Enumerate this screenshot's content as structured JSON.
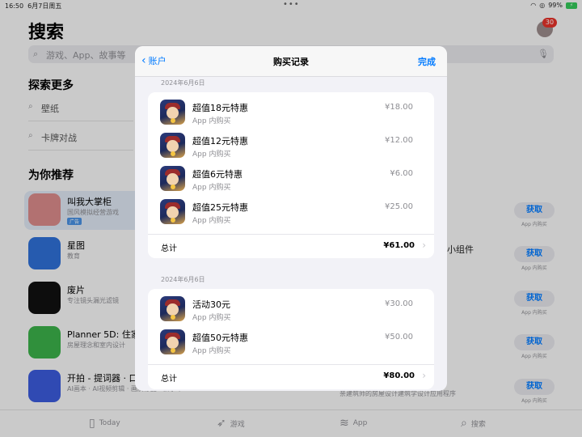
{
  "status_bar": {
    "time": "16:50",
    "date": "6月7日周五",
    "battery": "99%"
  },
  "background": {
    "title": "搜索",
    "badge": "30",
    "search_placeholder": "游戏、App、故事等",
    "explore_title": "探索更多",
    "suggestions": [
      "壁纸",
      "卡牌对战"
    ],
    "recommend_title": "为你推荐",
    "apps": [
      {
        "name": "叫我大掌柜",
        "sub": "国风模拟经营游戏",
        "ad": "广告",
        "icon_color": "#d98a8a"
      },
      {
        "name": "星图",
        "sub": "教育",
        "icon_color": "#2f6fd6"
      },
      {
        "name": "废片",
        "sub": "专注镜头漏光滤镜",
        "icon_color": "#111111"
      },
      {
        "name": "Planner 5D: 住家",
        "sub": "房屋理念和室内设计",
        "icon_color": "#3bb04a"
      },
      {
        "name": "开拍 - 提词器 · 口",
        "sub": "AI画本 · AI视频剪辑 · 画质修复 · 去水印",
        "icon_color": "#3b5bdb"
      }
    ],
    "get_label": "获取",
    "iap_label": "App 内购买",
    "right_texts": [
      "小组件",
      "亲建筑师的房屋设计建筑学设计应用程序"
    ],
    "tabs": [
      {
        "label": "Today",
        "icon": "today-icon"
      },
      {
        "label": "游戏",
        "icon": "rocket-icon"
      },
      {
        "label": "App",
        "icon": "stack-icon"
      },
      {
        "label": "搜索",
        "icon": "search-icon"
      }
    ]
  },
  "sheet": {
    "back_label": "账户",
    "title": "购买记录",
    "done_label": "完成",
    "groups": [
      {
        "date": "2024年6月6日",
        "items": [
          {
            "name": "超值18元特惠",
            "sub": "App 内购买",
            "price": "¥18.00"
          },
          {
            "name": "超值12元特惠",
            "sub": "App 内购买",
            "price": "¥12.00"
          },
          {
            "name": "超值6元特惠",
            "sub": "App 内购买",
            "price": "¥6.00"
          },
          {
            "name": "超值25元特惠",
            "sub": "App 内购买",
            "price": "¥25.00"
          }
        ],
        "total_label": "总计",
        "total_value": "¥61.00"
      },
      {
        "date": "2024年6月6日",
        "items": [
          {
            "name": "活动30元",
            "sub": "App 内购买",
            "price": "¥30.00"
          },
          {
            "name": "超值50元特惠",
            "sub": "App 内购买",
            "price": "¥50.00"
          }
        ],
        "total_label": "总计",
        "total_value": "¥80.00"
      }
    ]
  }
}
